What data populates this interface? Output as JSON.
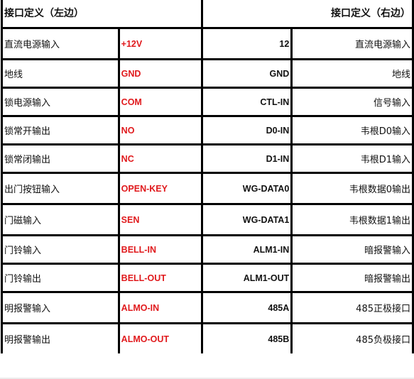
{
  "header": {
    "left_title": "接口定义（左边）",
    "right_title": "接口定义（右边）"
  },
  "rows": [
    {
      "left_desc": "直流电源输入",
      "left_pin": "+12V",
      "right_pin": "12",
      "right_desc": "直流电源输入"
    },
    {
      "left_desc": "地线",
      "left_pin": "GND",
      "right_pin": "GND",
      "right_desc": "地线"
    },
    {
      "left_desc": "锁电源输入",
      "left_pin": "COM",
      "right_pin": "CTL-IN",
      "right_desc": "信号输入"
    },
    {
      "left_desc": "锁常开输出",
      "left_pin": "NO",
      "right_pin": "D0-IN",
      "right_desc": "韦根D0输入"
    },
    {
      "left_desc": "锁常闭输出",
      "left_pin": "NC",
      "right_pin": "D1-IN",
      "right_desc": "韦根D1输入"
    },
    {
      "left_desc": "出门按钮输入",
      "left_pin": "OPEN-KEY",
      "right_pin": "WG-DATA0",
      "right_desc": "韦根数据0输出"
    },
    {
      "left_desc": "门磁输入",
      "left_pin": "SEN",
      "right_pin": "WG-DATA1",
      "right_desc": "韦根数据1输出"
    },
    {
      "left_desc": "门铃输入",
      "left_pin": "BELL-IN",
      "right_pin": "ALM1-IN",
      "right_desc": "暗报警输入"
    },
    {
      "left_desc": "门铃输出",
      "left_pin": "BELL-OUT",
      "right_pin": "ALM1-OUT",
      "right_desc": "暗报警输出"
    },
    {
      "left_desc": "明报警输入",
      "left_pin": "ALMO-IN",
      "right_pin": "485A",
      "right_desc": "485正极接口"
    },
    {
      "left_desc": "明报警输出",
      "left_pin": "ALMO-OUT",
      "right_pin": "485B",
      "right_desc": "485负极接口"
    }
  ],
  "colors": {
    "left_pin_text": "#e0191c",
    "grid_lines": "#000000"
  }
}
